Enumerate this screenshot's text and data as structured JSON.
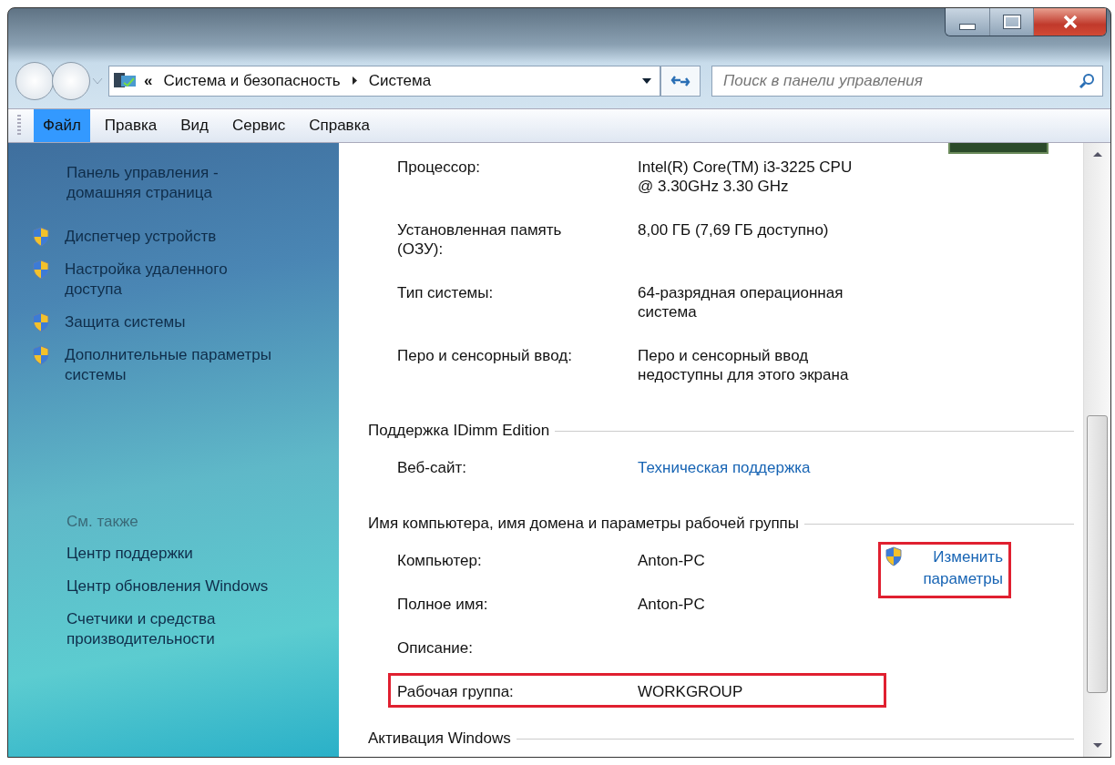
{
  "address_bar": {
    "overflow": "«",
    "crumbs": [
      {
        "label": "Система и безопасность"
      },
      {
        "label": "Система"
      }
    ]
  },
  "search": {
    "placeholder": "Поиск в панели управления"
  },
  "menu": [
    {
      "label": "Файл",
      "selected": true
    },
    {
      "label": "Правка",
      "selected": false
    },
    {
      "label": "Вид",
      "selected": false
    },
    {
      "label": "Сервис",
      "selected": false
    },
    {
      "label": "Справка",
      "selected": false
    }
  ],
  "sidebar": {
    "home": "Панель управления - домашняя страница",
    "tasks": [
      {
        "label": "Диспетчер устройств"
      },
      {
        "label": "Настройка удаленного доступа"
      },
      {
        "label": "Защита системы"
      },
      {
        "label": "Дополнительные параметры системы"
      }
    ],
    "see_also_title": "См. также",
    "see_also": [
      {
        "label": "Центр поддержки"
      },
      {
        "label": "Центр обновления Windows"
      },
      {
        "label": "Счетчики и средства производительности"
      }
    ]
  },
  "details": [
    {
      "kind": "row",
      "label": "Процессор:",
      "value": "Intel(R) Core(TM) i3-3225 CPU @ 3.30GHz  3.30 GHz",
      "highlighted": false
    },
    {
      "kind": "row",
      "label": "Установленная память (ОЗУ):",
      "value": "8,00 ГБ (7,69 ГБ доступно)",
      "highlighted": false
    },
    {
      "kind": "row",
      "label": "Тип системы:",
      "value": "64-разрядная операционная система",
      "highlighted": false
    },
    {
      "kind": "row",
      "label": "Перо и сенсорный ввод:",
      "value": "Перо и сенсорный ввод недоступны для этого экрана",
      "highlighted": false
    },
    {
      "kind": "section",
      "title": "Поддержка IDimm Edition"
    },
    {
      "kind": "row",
      "label": "Веб-сайт:",
      "value": "Техническая поддержка",
      "link": true,
      "highlighted": false
    },
    {
      "kind": "section",
      "title": "Имя компьютера, имя домена и параметры рабочей группы"
    },
    {
      "kind": "row",
      "label": "Компьютер:",
      "value": "Anton-PC",
      "highlighted": false,
      "action": {
        "label": "Изменить параметры",
        "highlighted": true
      }
    },
    {
      "kind": "row",
      "label": "Полное имя:",
      "value": "Anton-PC",
      "highlighted": false
    },
    {
      "kind": "row",
      "label": "Описание:",
      "highlighted": false
    },
    {
      "kind": "row",
      "label": "Рабочая группа:",
      "value": "WORKGROUP",
      "highlighted": true
    },
    {
      "kind": "section",
      "title": "Активация Windows"
    }
  ]
}
